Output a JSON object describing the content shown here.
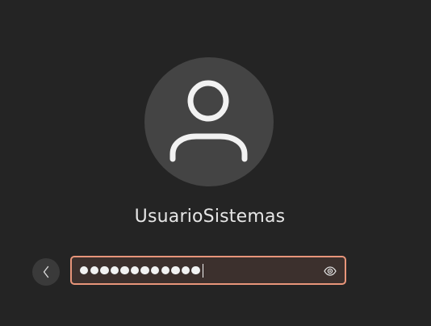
{
  "user": {
    "name": "UsuarioSistemas"
  },
  "password": {
    "masked_length": 12
  },
  "icons": {
    "avatar": "person-icon",
    "back": "chevron-left-icon",
    "reveal": "eye-icon"
  },
  "colors": {
    "background": "#242424",
    "avatar_bg": "#444444",
    "field_border": "#e8957a",
    "field_bg": "#3c302d",
    "text": "#e6e6e6"
  }
}
